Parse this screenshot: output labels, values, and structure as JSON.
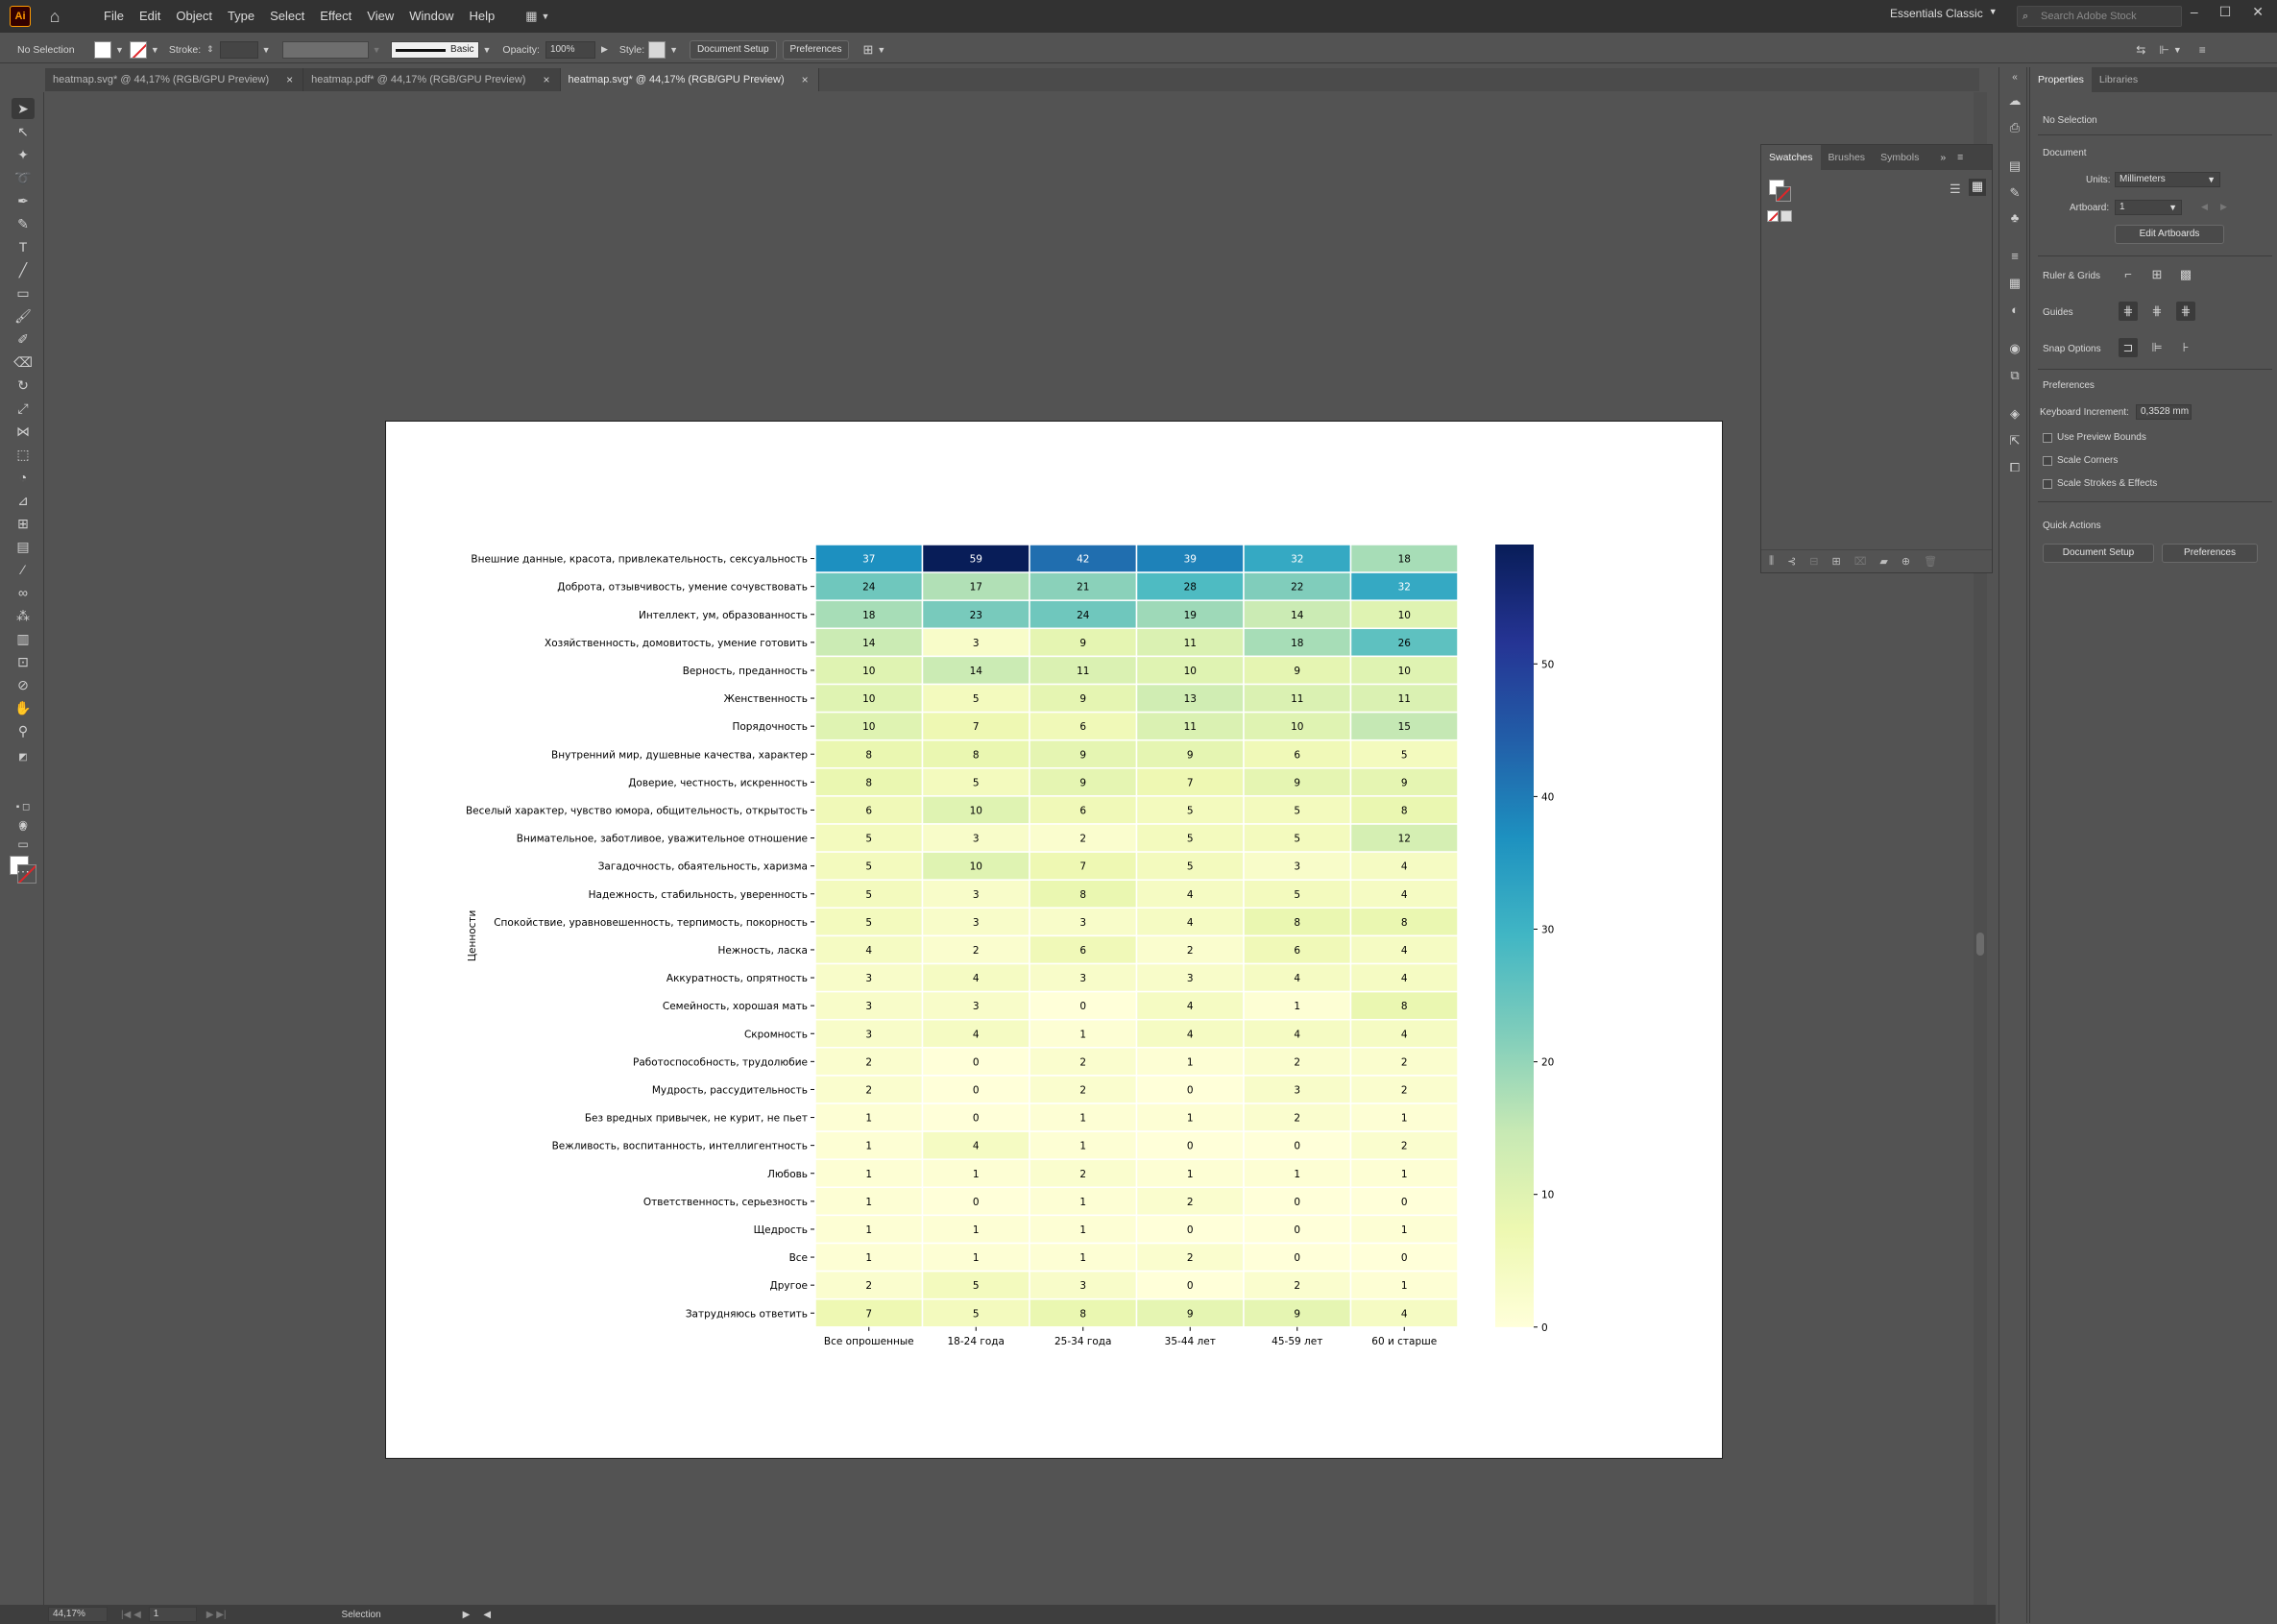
{
  "app": {
    "logo": "Ai",
    "menu": [
      "File",
      "Edit",
      "Object",
      "Type",
      "Select",
      "Effect",
      "View",
      "Window",
      "Help"
    ],
    "workspace": "Essentials Classic",
    "stock_search_placeholder": "Search Adobe Stock"
  },
  "control_bar": {
    "selection": "No Selection",
    "stroke_label": "Stroke:",
    "brush_label": "Basic",
    "opacity_label": "Opacity:",
    "opacity_value": "100%",
    "style_label": "Style:",
    "document_setup": "Document Setup",
    "preferences": "Preferences"
  },
  "tabs": [
    {
      "label": "heatmap.svg* @ 44,17% (RGB/GPU Preview)",
      "active": false
    },
    {
      "label": "heatmap.pdf* @ 44,17% (RGB/GPU Preview)",
      "active": false
    },
    {
      "label": "heatmap.svg* @ 44,17% (RGB/GPU Preview)",
      "active": true
    }
  ],
  "status_bar": {
    "zoom": "44,17%",
    "artboard": "1",
    "tool": "Selection"
  },
  "swatches_panel": {
    "tabs": [
      "Swatches",
      "Brushes",
      "Symbols"
    ]
  },
  "properties": {
    "tabs": [
      "Properties",
      "Libraries"
    ],
    "selection": "No Selection",
    "document_header": "Document",
    "units_label": "Units:",
    "units_value": "Millimeters",
    "artboard_label": "Artboard:",
    "artboard_value": "1",
    "edit_artboards": "Edit Artboards",
    "rulers_grids": "Ruler & Grids",
    "guides": "Guides",
    "snap_options": "Snap Options",
    "preferences_header": "Preferences",
    "keyboard_increment_label": "Keyboard Increment:",
    "keyboard_increment_value": "0,3528 mm",
    "use_preview_bounds": "Use Preview Bounds",
    "scale_corners": "Scale Corners",
    "scale_strokes": "Scale Strokes & Effects",
    "quick_actions": "Quick Actions",
    "document_setup": "Document Setup",
    "preferences": "Preferences"
  },
  "colors": {
    "accent_ai": "#ff9a00",
    "none_red": "#e0262a"
  },
  "chart_data": {
    "type": "heatmap",
    "ylabel": "Ценности",
    "colormap": "YlGnBu",
    "vmin": 0,
    "vmax": 59,
    "colorbar_ticks": [
      0,
      10,
      20,
      30,
      40,
      50
    ],
    "columns": [
      "Все опрошенные",
      "18-24 года",
      "25-34 года",
      "35-44 лет",
      "45-59 лет",
      "60 и старше"
    ],
    "rows": [
      {
        "label": "Внешние данные, красота, привлекательность, сексуальность",
        "values": [
          37,
          59,
          42,
          39,
          32,
          18
        ]
      },
      {
        "label": "Доброта, отзывчивость, умение сочувствовать",
        "values": [
          24,
          17,
          21,
          28,
          22,
          32
        ]
      },
      {
        "label": "Интеллект, ум, образованность",
        "values": [
          18,
          23,
          24,
          19,
          14,
          10
        ]
      },
      {
        "label": "Хозяйственность, домовитость, умение готовить",
        "values": [
          14,
          3,
          9,
          11,
          18,
          26
        ]
      },
      {
        "label": "Верность, преданность",
        "values": [
          10,
          14,
          11,
          10,
          9,
          10
        ]
      },
      {
        "label": "Женственность",
        "values": [
          10,
          5,
          9,
          13,
          11,
          11
        ]
      },
      {
        "label": "Порядочность",
        "values": [
          10,
          7,
          6,
          11,
          10,
          15
        ]
      },
      {
        "label": "Внутренний мир, душевные качества, характер",
        "values": [
          8,
          8,
          9,
          9,
          6,
          5
        ]
      },
      {
        "label": "Доверие, честность, искренность",
        "values": [
          8,
          5,
          9,
          7,
          9,
          9
        ]
      },
      {
        "label": "Веселый характер, чувство юмора, общительность, открытость",
        "values": [
          6,
          10,
          6,
          5,
          5,
          8
        ]
      },
      {
        "label": "Внимательное, заботливое, уважительное отношение",
        "values": [
          5,
          3,
          2,
          5,
          5,
          12
        ]
      },
      {
        "label": "Загадочность, обаятельность, харизма",
        "values": [
          5,
          10,
          7,
          5,
          3,
          4
        ]
      },
      {
        "label": "Надежность, стабильность, уверенность",
        "values": [
          5,
          3,
          8,
          4,
          5,
          4
        ]
      },
      {
        "label": "Спокойствие, уравновешенность, терпимость, покорность",
        "values": [
          5,
          3,
          3,
          4,
          8,
          8
        ]
      },
      {
        "label": "Нежность, ласка",
        "values": [
          4,
          2,
          6,
          2,
          6,
          4
        ]
      },
      {
        "label": "Аккуратность, опрятность",
        "values": [
          3,
          4,
          3,
          3,
          4,
          4
        ]
      },
      {
        "label": "Семейность, хорошая мать",
        "values": [
          3,
          3,
          0,
          4,
          1,
          8
        ]
      },
      {
        "label": "Скромность",
        "values": [
          3,
          4,
          1,
          4,
          4,
          4
        ]
      },
      {
        "label": "Работоспособность, трудолюбие",
        "values": [
          2,
          0,
          2,
          1,
          2,
          2
        ]
      },
      {
        "label": "Мудрость, рассудительность",
        "values": [
          2,
          0,
          2,
          0,
          3,
          2
        ]
      },
      {
        "label": "Без вредных привычек, не курит, не пьет",
        "values": [
          1,
          0,
          1,
          1,
          2,
          1
        ]
      },
      {
        "label": "Вежливость, воспитанность, интеллигентность",
        "values": [
          1,
          4,
          1,
          0,
          0,
          2
        ]
      },
      {
        "label": "Любовь",
        "values": [
          1,
          1,
          2,
          1,
          1,
          1
        ]
      },
      {
        "label": "Ответственность, серьезность",
        "values": [
          1,
          0,
          1,
          2,
          0,
          0
        ]
      },
      {
        "label": "Щедрость",
        "values": [
          1,
          1,
          1,
          0,
          0,
          1
        ]
      },
      {
        "label": "Все",
        "values": [
          1,
          1,
          1,
          2,
          0,
          0
        ]
      },
      {
        "label": "Другое",
        "values": [
          2,
          5,
          3,
          0,
          2,
          1
        ]
      },
      {
        "label": "Затрудняюсь ответить",
        "values": [
          7,
          5,
          8,
          9,
          9,
          4
        ]
      }
    ]
  }
}
